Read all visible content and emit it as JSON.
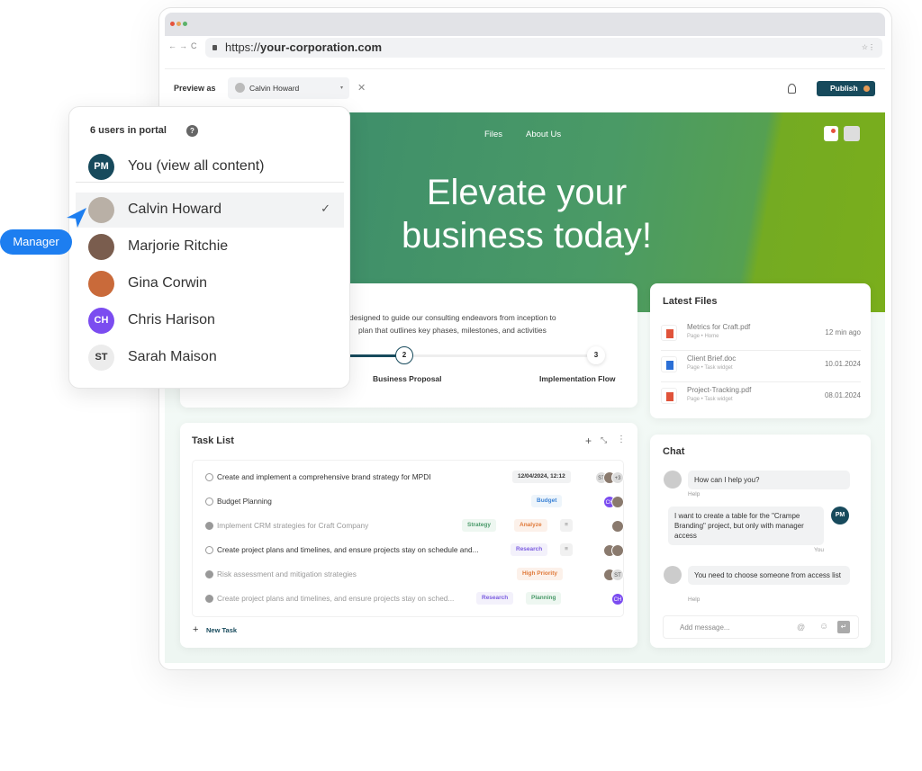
{
  "browser": {
    "url_prefix": "https://",
    "url_domain": "your-corporation.com",
    "nav_back": "←",
    "nav_forward": "→",
    "nav_reload": "C"
  },
  "toolbar": {
    "preview_label": "Preview as",
    "preview_value": "Calvin Howard",
    "clear": "✕",
    "publish": "Publish"
  },
  "hero": {
    "nav": [
      "Files",
      "About Us"
    ],
    "title": "Elevate your business today!"
  },
  "popup": {
    "header": "6 users in portal",
    "help": "?",
    "users": [
      {
        "initials": "PM",
        "name": "You (view all content)",
        "color": "#174a5c"
      },
      {
        "initials": "",
        "name": "Calvin Howard",
        "selected": true,
        "check": "✓"
      },
      {
        "initials": "",
        "name": "Marjorie Ritchie"
      },
      {
        "initials": "",
        "name": "Gina Corwin"
      },
      {
        "initials": "CH",
        "name": "Chris Harison",
        "color": "#7b4cf0"
      },
      {
        "initials": "ST",
        "name": "Sarah Maison",
        "color": "#ececec"
      }
    ]
  },
  "tooltip": {
    "role": "Manager"
  },
  "plan": {
    "desc1": "designed to guide our consulting endeavors from inception to",
    "desc2": "plan that outlines key phases, milestones, and activities",
    "steps": [
      {
        "num": "2",
        "label": "Business Proposal"
      },
      {
        "num": "3",
        "label": "Implementation Flow"
      }
    ]
  },
  "tasks": {
    "title": "Task List",
    "new": "New Task",
    "items": [
      {
        "text": "Create and implement a comprehensive brand strategy for MPDI",
        "done": false,
        "date": "12/04/2024, 12:12",
        "avatars": [
          "ST",
          "",
          "+3"
        ]
      },
      {
        "text": "Budget Planning",
        "done": false,
        "tags": [
          "Budget"
        ],
        "avatars": [
          "CH",
          ""
        ]
      },
      {
        "text": "Implement CRM strategies for Craft Company",
        "done": true,
        "tags": [
          "Strategy",
          "Analyze"
        ],
        "avatars": [
          ""
        ]
      },
      {
        "text": "Create project plans and timelines, and ensure projects stay on schedule and...",
        "done": false,
        "tags": [
          "Research"
        ],
        "avatars": [
          "",
          ""
        ]
      },
      {
        "text": "Risk assessment and mitigation strategies",
        "done": true,
        "tags": [
          "High Priority"
        ],
        "avatars": [
          "",
          "ST"
        ]
      },
      {
        "text": "Create project plans and timelines, and ensure projects stay on sched...",
        "done": true,
        "tags": [
          "Research",
          "Planning"
        ],
        "avatars": [
          "CH"
        ]
      }
    ]
  },
  "files": {
    "title": "Latest Files",
    "items": [
      {
        "name": "Metrics for Craft.pdf",
        "sub": "Page • Home",
        "date": "12 min ago",
        "type": "pdf"
      },
      {
        "name": "Client Brief.doc",
        "sub": "Page • Task widget",
        "date": "10.01.2024",
        "type": "doc"
      },
      {
        "name": "Project-Tracking.pdf",
        "sub": "Page • Task widget",
        "date": "08.01.2024",
        "type": "pdf"
      }
    ]
  },
  "chat": {
    "title": "Chat",
    "messages": [
      {
        "text": "How can I help you?",
        "author": "Help"
      },
      {
        "text": "I want to create a table for the \"Crampe Branding\" project, but only with manager access",
        "author": "You",
        "initials": "PM"
      },
      {
        "text": "You need to choose someone from access list",
        "author": "Help"
      }
    ],
    "placeholder": "Add message..."
  },
  "colors": {
    "accent": "#174a5c",
    "manager": "#1d7ef0",
    "purple": "#7b4cf0"
  }
}
